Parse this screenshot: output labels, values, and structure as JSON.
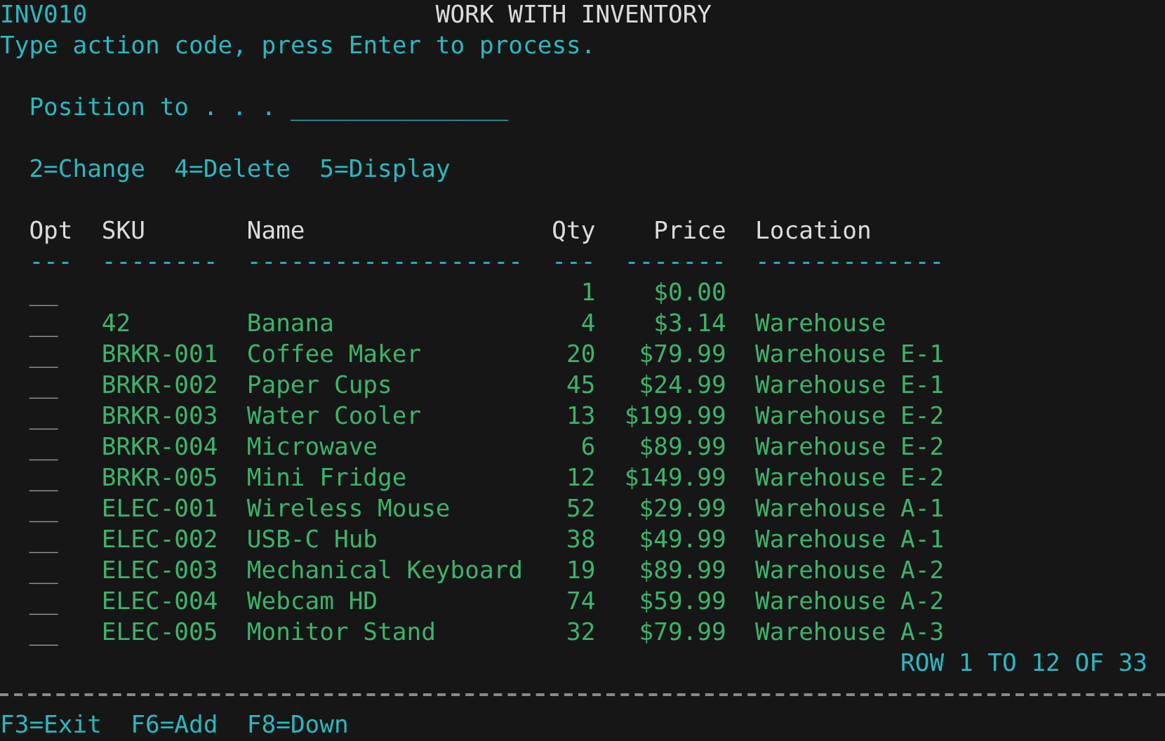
{
  "program_id": "INV010",
  "title": "WORK WITH INVENTORY",
  "instruction": "Type action code, press Enter to process.",
  "position_to": {
    "label": "Position to . . .",
    "field": "_______________"
  },
  "options": [
    "2=Change",
    "4=Delete",
    "5=Display"
  ],
  "columns": [
    {
      "label": "Opt",
      "underline": "---"
    },
    {
      "label": "SKU",
      "underline": "--------"
    },
    {
      "label": "Name",
      "underline": "-------------------"
    },
    {
      "label": "Qty",
      "underline": "---"
    },
    {
      "label": "Price",
      "underline": "-------"
    },
    {
      "label": "Location",
      "underline": "-------------"
    }
  ],
  "rows": [
    {
      "opt": "__",
      "qty": "1",
      "price": "$0.00"
    },
    {
      "opt": "__",
      "sku": "42",
      "name": "Banana",
      "qty": "4",
      "price": "$3.14",
      "location": "Warehouse"
    },
    {
      "opt": "__",
      "sku": "BRKR-001",
      "name": "Coffee Maker",
      "qty": "20",
      "price": "$79.99",
      "location": "Warehouse E-1"
    },
    {
      "opt": "__",
      "sku": "BRKR-002",
      "name": "Paper Cups",
      "qty": "45",
      "price": "$24.99",
      "location": "Warehouse E-1"
    },
    {
      "opt": "__",
      "sku": "BRKR-003",
      "name": "Water Cooler",
      "qty": "13",
      "price": "$199.99",
      "location": "Warehouse E-2"
    },
    {
      "opt": "__",
      "sku": "BRKR-004",
      "name": "Microwave",
      "qty": "6",
      "price": "$89.99",
      "location": "Warehouse E-2"
    },
    {
      "opt": "__",
      "sku": "BRKR-005",
      "name": "Mini Fridge",
      "qty": "12",
      "price": "$149.99",
      "location": "Warehouse E-2"
    },
    {
      "opt": "__",
      "sku": "ELEC-001",
      "name": "Wireless Mouse",
      "qty": "52",
      "price": "$29.99",
      "location": "Warehouse A-1"
    },
    {
      "opt": "__",
      "sku": "ELEC-002",
      "name": "USB-C Hub",
      "qty": "38",
      "price": "$49.99",
      "location": "Warehouse A-1"
    },
    {
      "opt": "__",
      "sku": "ELEC-003",
      "name": "Mechanical Keyboard",
      "qty": "19",
      "price": "$89.99",
      "location": "Warehouse A-2"
    },
    {
      "opt": "__",
      "sku": "ELEC-004",
      "name": "Webcam HD",
      "qty": "74",
      "price": "$59.99",
      "location": "Warehouse A-2"
    },
    {
      "opt": "__",
      "sku": "ELEC-005",
      "name": "Monitor Stand",
      "qty": "32",
      "price": "$79.99",
      "location": "Warehouse A-3"
    }
  ],
  "row_indicator": "ROW 1 TO 12 OF 33",
  "function_keys": [
    "F3=Exit",
    "F6=Add",
    "F8=Down"
  ]
}
